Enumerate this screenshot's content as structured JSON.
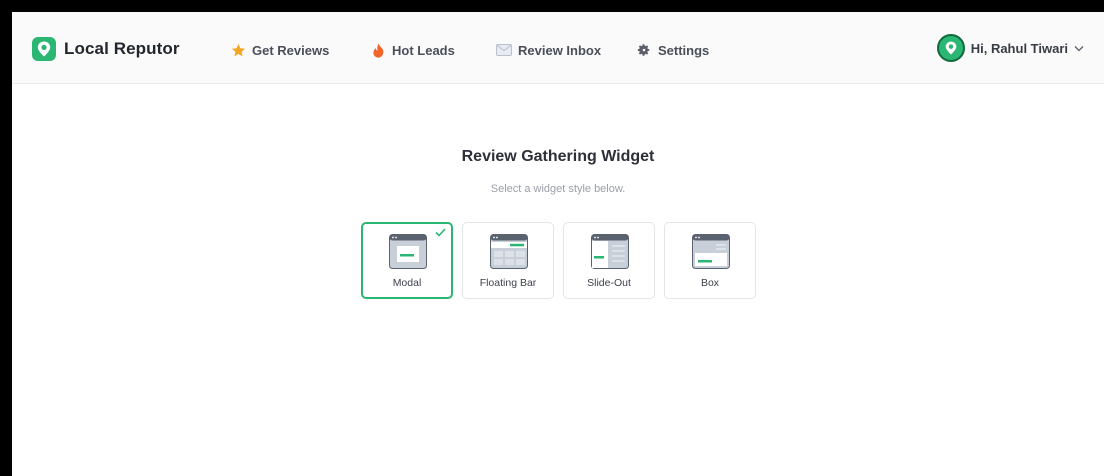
{
  "app": {
    "brand_name": "Local Reputor"
  },
  "nav": {
    "items": [
      {
        "label": "Get Reviews",
        "icon": "star-icon"
      },
      {
        "label": "Hot Leads",
        "icon": "fire-icon"
      },
      {
        "label": "Review Inbox",
        "icon": "envelope-icon"
      },
      {
        "label": "Settings",
        "icon": "gear-icon"
      }
    ]
  },
  "user": {
    "greeting": "Hi, Rahul Tiwari"
  },
  "main": {
    "title": "Review Gathering Widget",
    "subtitle": "Select a widget style below.",
    "styles": [
      {
        "label": "Modal",
        "selected": true
      },
      {
        "label": "Floating Bar",
        "selected": false
      },
      {
        "label": "Slide-Out",
        "selected": false
      },
      {
        "label": "Box",
        "selected": false
      }
    ]
  },
  "colors": {
    "accent": "#2bb673",
    "star": "#f5a623",
    "fire": "#f0662a",
    "text": "#2d3038"
  }
}
